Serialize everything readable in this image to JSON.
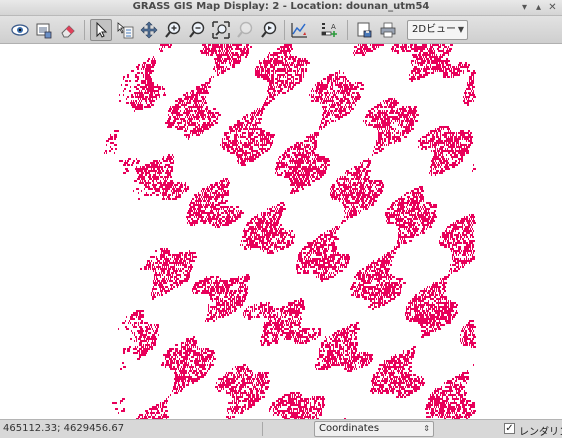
{
  "window": {
    "title": "GRASS GIS Map Display: 2  - Location: dounan_utm54"
  },
  "toolbar": {
    "tools": [
      {
        "name": "display-map-icon"
      },
      {
        "name": "render-map-icon"
      },
      {
        "name": "erase-display-icon"
      },
      {
        "name": "pointer-icon",
        "active": true
      },
      {
        "name": "query-icon"
      },
      {
        "name": "pan-icon"
      },
      {
        "name": "zoom-in-icon"
      },
      {
        "name": "zoom-out-icon"
      },
      {
        "name": "zoom-extent-icon"
      },
      {
        "name": "zoom-back-icon"
      },
      {
        "name": "zoom-menu-icon"
      },
      {
        "name": "analyze-icon"
      },
      {
        "name": "decoration-icon"
      },
      {
        "name": "save-image-icon"
      },
      {
        "name": "print-icon"
      }
    ],
    "view_mode": "2Dビュー"
  },
  "map": {
    "raster_color": "#e8005a"
  },
  "statusbar": {
    "coordinates": "465112.33; 4629456.67",
    "mode_selected": "Coordinates",
    "render_label": "レンダリング",
    "render_checked": true
  }
}
